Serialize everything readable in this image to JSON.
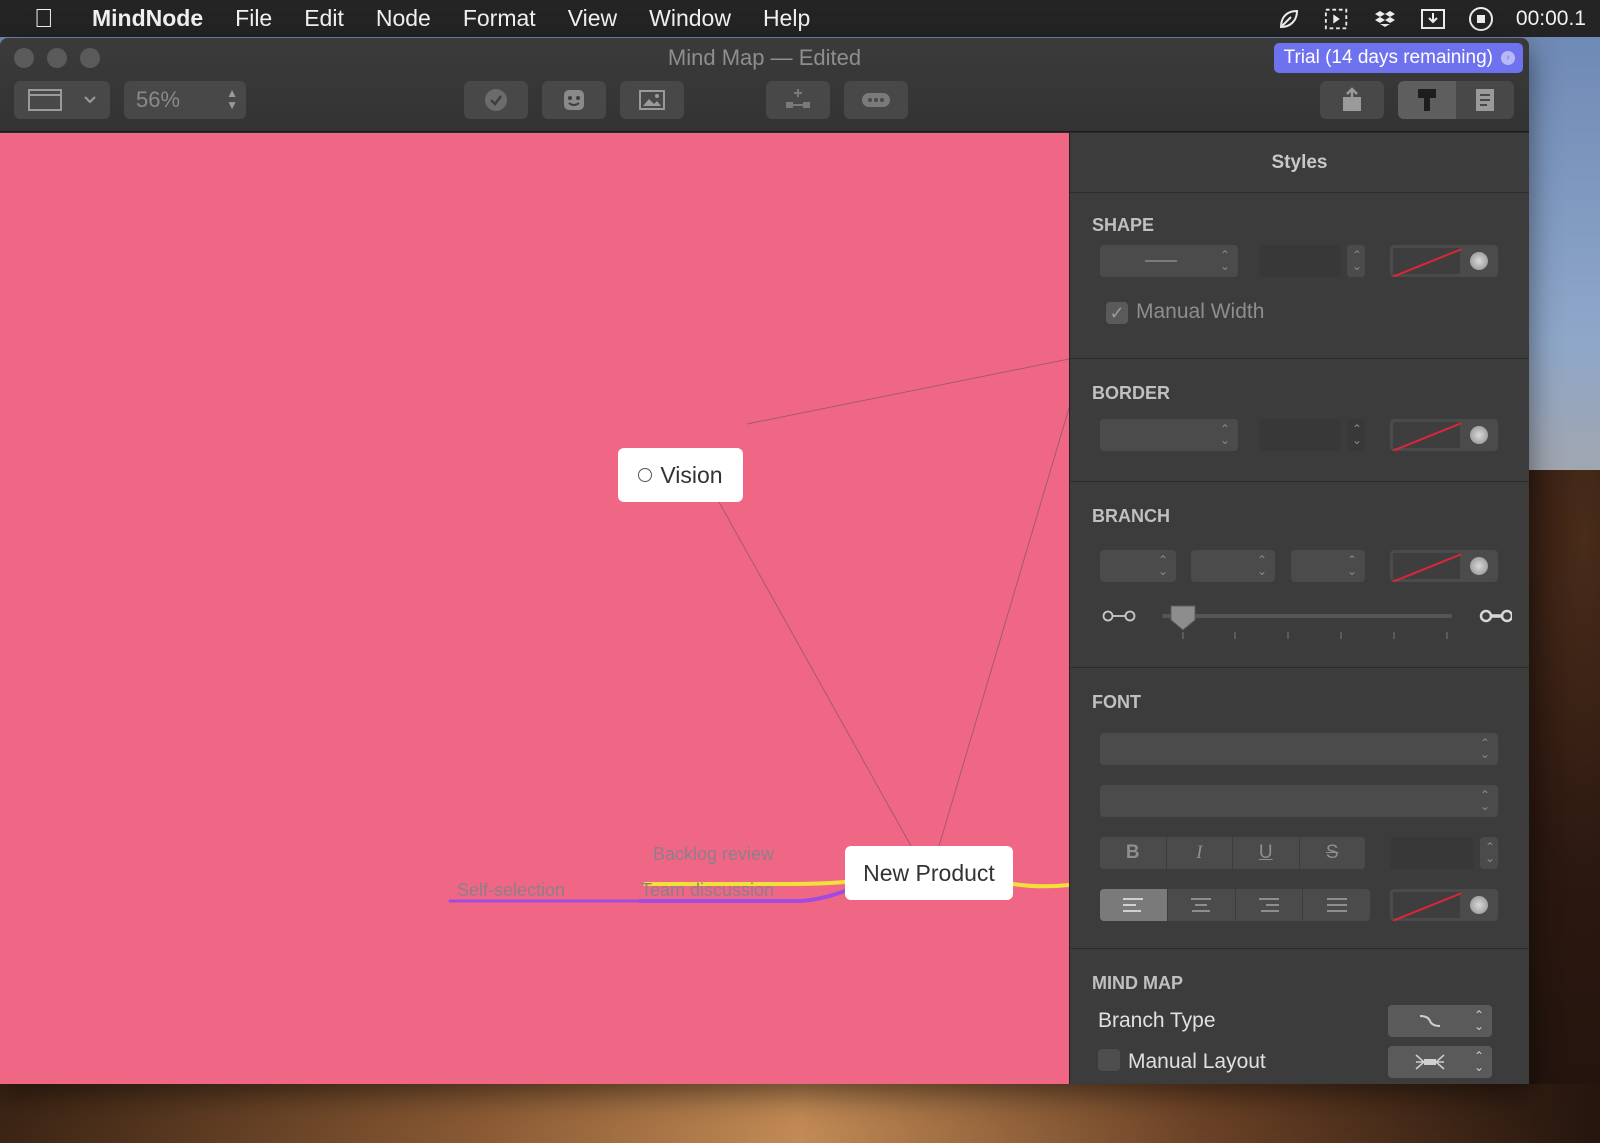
{
  "menubar": {
    "app_name": "MindNode",
    "items": [
      "File",
      "Edit",
      "Node",
      "Format",
      "View",
      "Window",
      "Help"
    ],
    "clock": "00:00.1"
  },
  "window": {
    "title": "Mind Map — Edited",
    "trial_badge": "Trial (14 days remaining)",
    "zoom": "56%"
  },
  "map": {
    "nodes": {
      "vision": "Vision",
      "new_product": "New Product"
    },
    "branches": {
      "backlog_review": "Backlog review",
      "team_discussion": "Team discussion",
      "self_selection": "Self-selection"
    },
    "colors": {
      "canvas": "#f06786",
      "yellow_branch": "#f2e03a",
      "purple_branch": "#a24be0"
    }
  },
  "inspector": {
    "title": "Styles",
    "shape": {
      "title": "SHAPE",
      "manual_width": "Manual Width"
    },
    "border": {
      "title": "BORDER"
    },
    "branch": {
      "title": "BRANCH"
    },
    "font": {
      "title": "FONT",
      "bold": "B",
      "italic": "I",
      "underline": "U",
      "strike": "S"
    },
    "mind_map": {
      "title": "MIND MAP",
      "branch_type": "Branch Type",
      "manual_layout": "Manual Layout"
    }
  }
}
